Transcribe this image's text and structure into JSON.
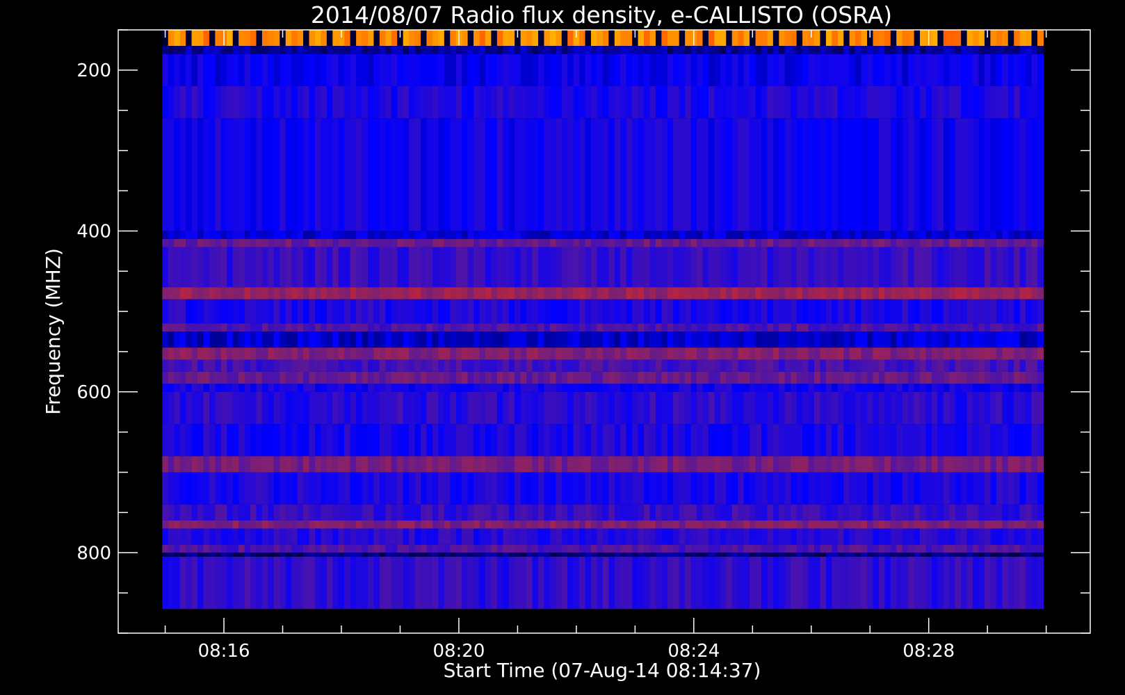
{
  "chart_data": {
    "type": "heatmap",
    "title": "2014/08/07  Radio flux density, e-CALLISTO (OSRA)",
    "xlabel": "Start Time (07-Aug-14 08:14:37)",
    "ylabel": "Frequency (MHZ)",
    "x_tick_labels": [
      "08:16",
      "08:20",
      "08:24",
      "08:28"
    ],
    "x_ticks_minutes": [
      16,
      20,
      24,
      28
    ],
    "x_minor_step_minutes": 1,
    "xlim_minutes": [
      14.2,
      30.75
    ],
    "data_x_range_minutes": [
      14.95,
      29.95
    ],
    "y_ticks": [
      200,
      400,
      600,
      800
    ],
    "y_minor_step": 50,
    "ylim": [
      150,
      900
    ],
    "y_inverted": true,
    "data_y_range": [
      170,
      870
    ],
    "colormap": [
      "#000000",
      "#0000ff",
      "#7f2070",
      "#ff2a00",
      "#ffb000"
    ],
    "background_color": "#000000",
    "axes_color": "#ffffff",
    "frequency_bands": [
      {
        "f0": 150,
        "f1": 170,
        "level": 0.95
      },
      {
        "f0": 170,
        "f1": 180,
        "level": 0.15
      },
      {
        "f0": 180,
        "f1": 220,
        "level": 0.25
      },
      {
        "f0": 220,
        "f1": 260,
        "level": 0.3
      },
      {
        "f0": 260,
        "f1": 400,
        "level": 0.28
      },
      {
        "f0": 400,
        "f1": 410,
        "level": 0.22
      },
      {
        "f0": 410,
        "f1": 420,
        "level": 0.45
      },
      {
        "f0": 420,
        "f1": 470,
        "level": 0.35
      },
      {
        "f0": 470,
        "f1": 485,
        "level": 0.55
      },
      {
        "f0": 485,
        "f1": 515,
        "level": 0.3
      },
      {
        "f0": 515,
        "f1": 525,
        "level": 0.4
      },
      {
        "f0": 525,
        "f1": 545,
        "level": 0.2
      },
      {
        "f0": 545,
        "f1": 560,
        "level": 0.5
      },
      {
        "f0": 560,
        "f1": 575,
        "level": 0.38
      },
      {
        "f0": 575,
        "f1": 590,
        "level": 0.45
      },
      {
        "f0": 590,
        "f1": 600,
        "level": 0.28
      },
      {
        "f0": 600,
        "f1": 640,
        "level": 0.33
      },
      {
        "f0": 640,
        "f1": 680,
        "level": 0.3
      },
      {
        "f0": 680,
        "f1": 700,
        "level": 0.48
      },
      {
        "f0": 700,
        "f1": 740,
        "level": 0.3
      },
      {
        "f0": 740,
        "f1": 760,
        "level": 0.35
      },
      {
        "f0": 760,
        "f1": 770,
        "level": 0.5
      },
      {
        "f0": 770,
        "f1": 790,
        "level": 0.32
      },
      {
        "f0": 790,
        "f1": 800,
        "level": 0.4
      },
      {
        "f0": 800,
        "f1": 805,
        "level": 0.12
      },
      {
        "f0": 805,
        "f1": 870,
        "level": 0.34
      }
    ]
  }
}
